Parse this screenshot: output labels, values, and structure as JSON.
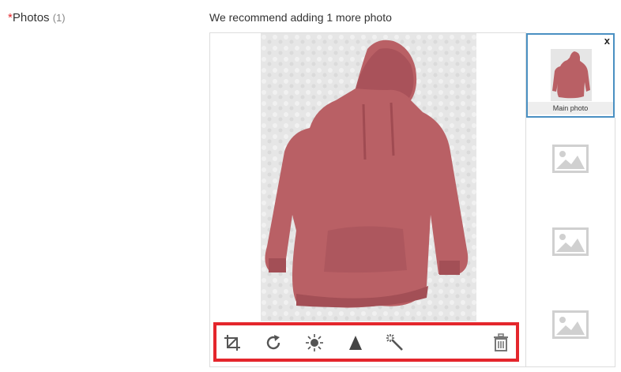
{
  "field": {
    "required_marker": "*",
    "label": "Photos",
    "count": "(1)"
  },
  "recommendation": "We recommend adding 1 more photo",
  "main_photo": {
    "subject": "pink hooded sweatshirt on white blanket"
  },
  "toolbar": {
    "tools": [
      {
        "name": "crop",
        "icon": "crop-icon"
      },
      {
        "name": "rotate",
        "icon": "rotate-icon"
      },
      {
        "name": "brightness",
        "icon": "brightness-icon"
      },
      {
        "name": "contrast",
        "icon": "contrast-icon"
      },
      {
        "name": "auto-enhance",
        "icon": "magic-wand-icon"
      },
      {
        "name": "delete",
        "icon": "trash-icon"
      }
    ],
    "highlight_color": "#e4262c"
  },
  "thumbnails": {
    "active": {
      "close_label": "x",
      "caption": "Main photo"
    },
    "empty_slots": 3,
    "active_border_color": "#4a90c2"
  }
}
